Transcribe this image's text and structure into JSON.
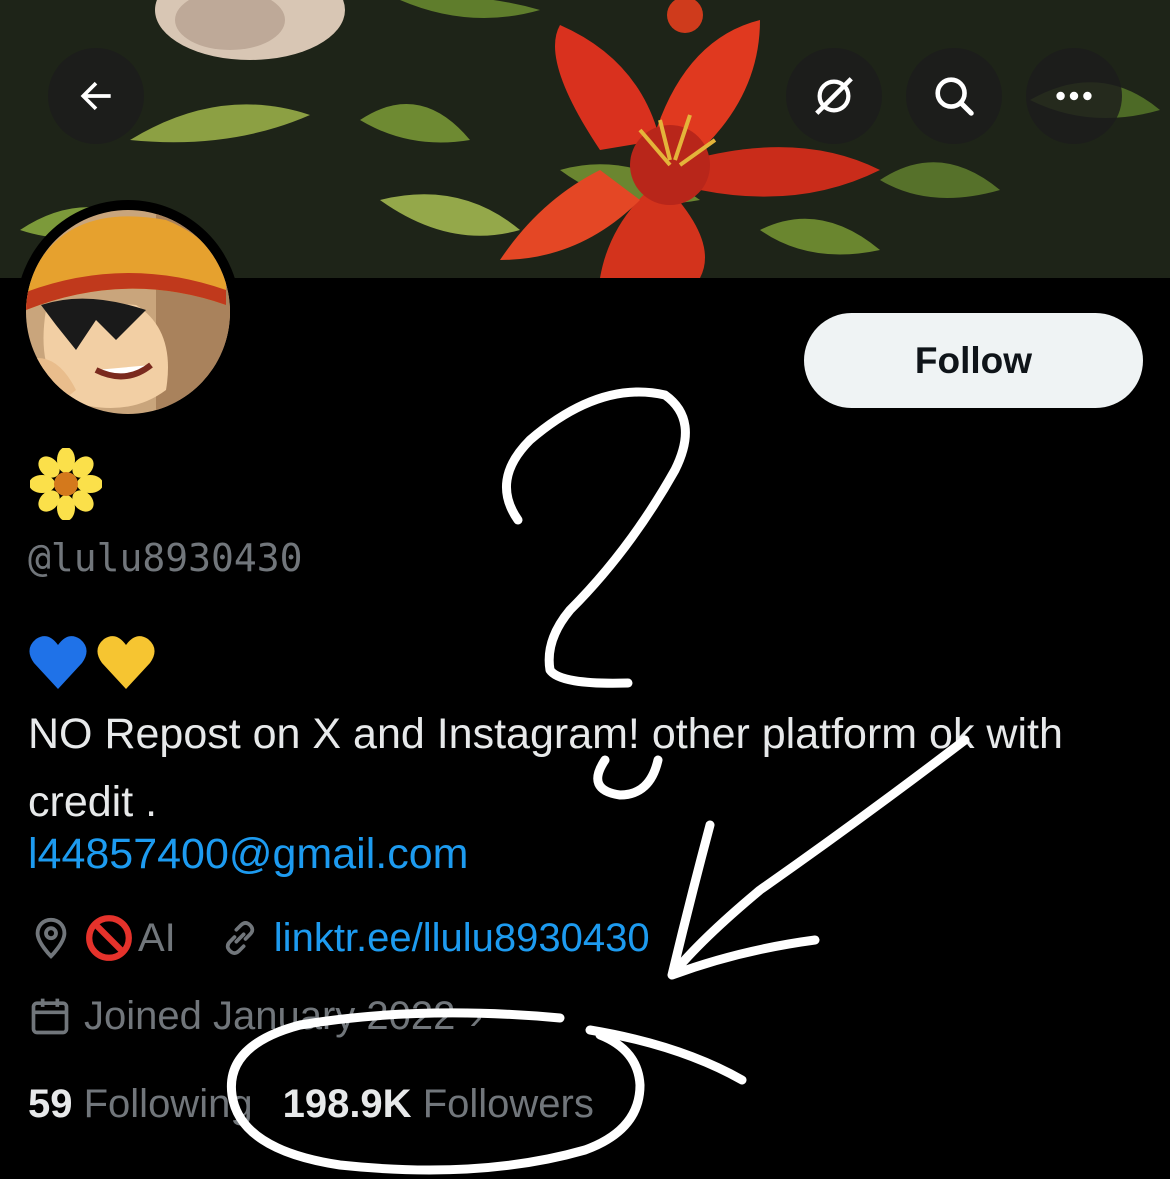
{
  "header": {
    "back_icon": "arrow-left-icon",
    "grok_icon": "grok-icon",
    "search_icon": "search-icon",
    "more_icon": "more-horizontal-icon"
  },
  "profile": {
    "follow_label": "Follow",
    "name_emoji": "flower-emoji",
    "handle": "@lulu8930430",
    "bio_emojis": [
      "blue-heart-emoji",
      "yellow-heart-emoji"
    ],
    "bio": "NO Repost on X and Instagram! other platform ok with credit .",
    "bio_email": "l44857400@gmail.com",
    "location": "AI",
    "location_emoji": "prohibited-emoji",
    "website": "linktr.ee/llulu8930430",
    "joined": "Joined January 2022"
  },
  "stats": {
    "following_count": "59",
    "following_label": "Following",
    "followers_count": "198.9K",
    "followers_label": "Followers"
  },
  "colors": {
    "background": "#000000",
    "text": "#e7e9ea",
    "muted": "#71767b",
    "link": "#1d9bf0",
    "follow_bg": "#eff3f4"
  }
}
